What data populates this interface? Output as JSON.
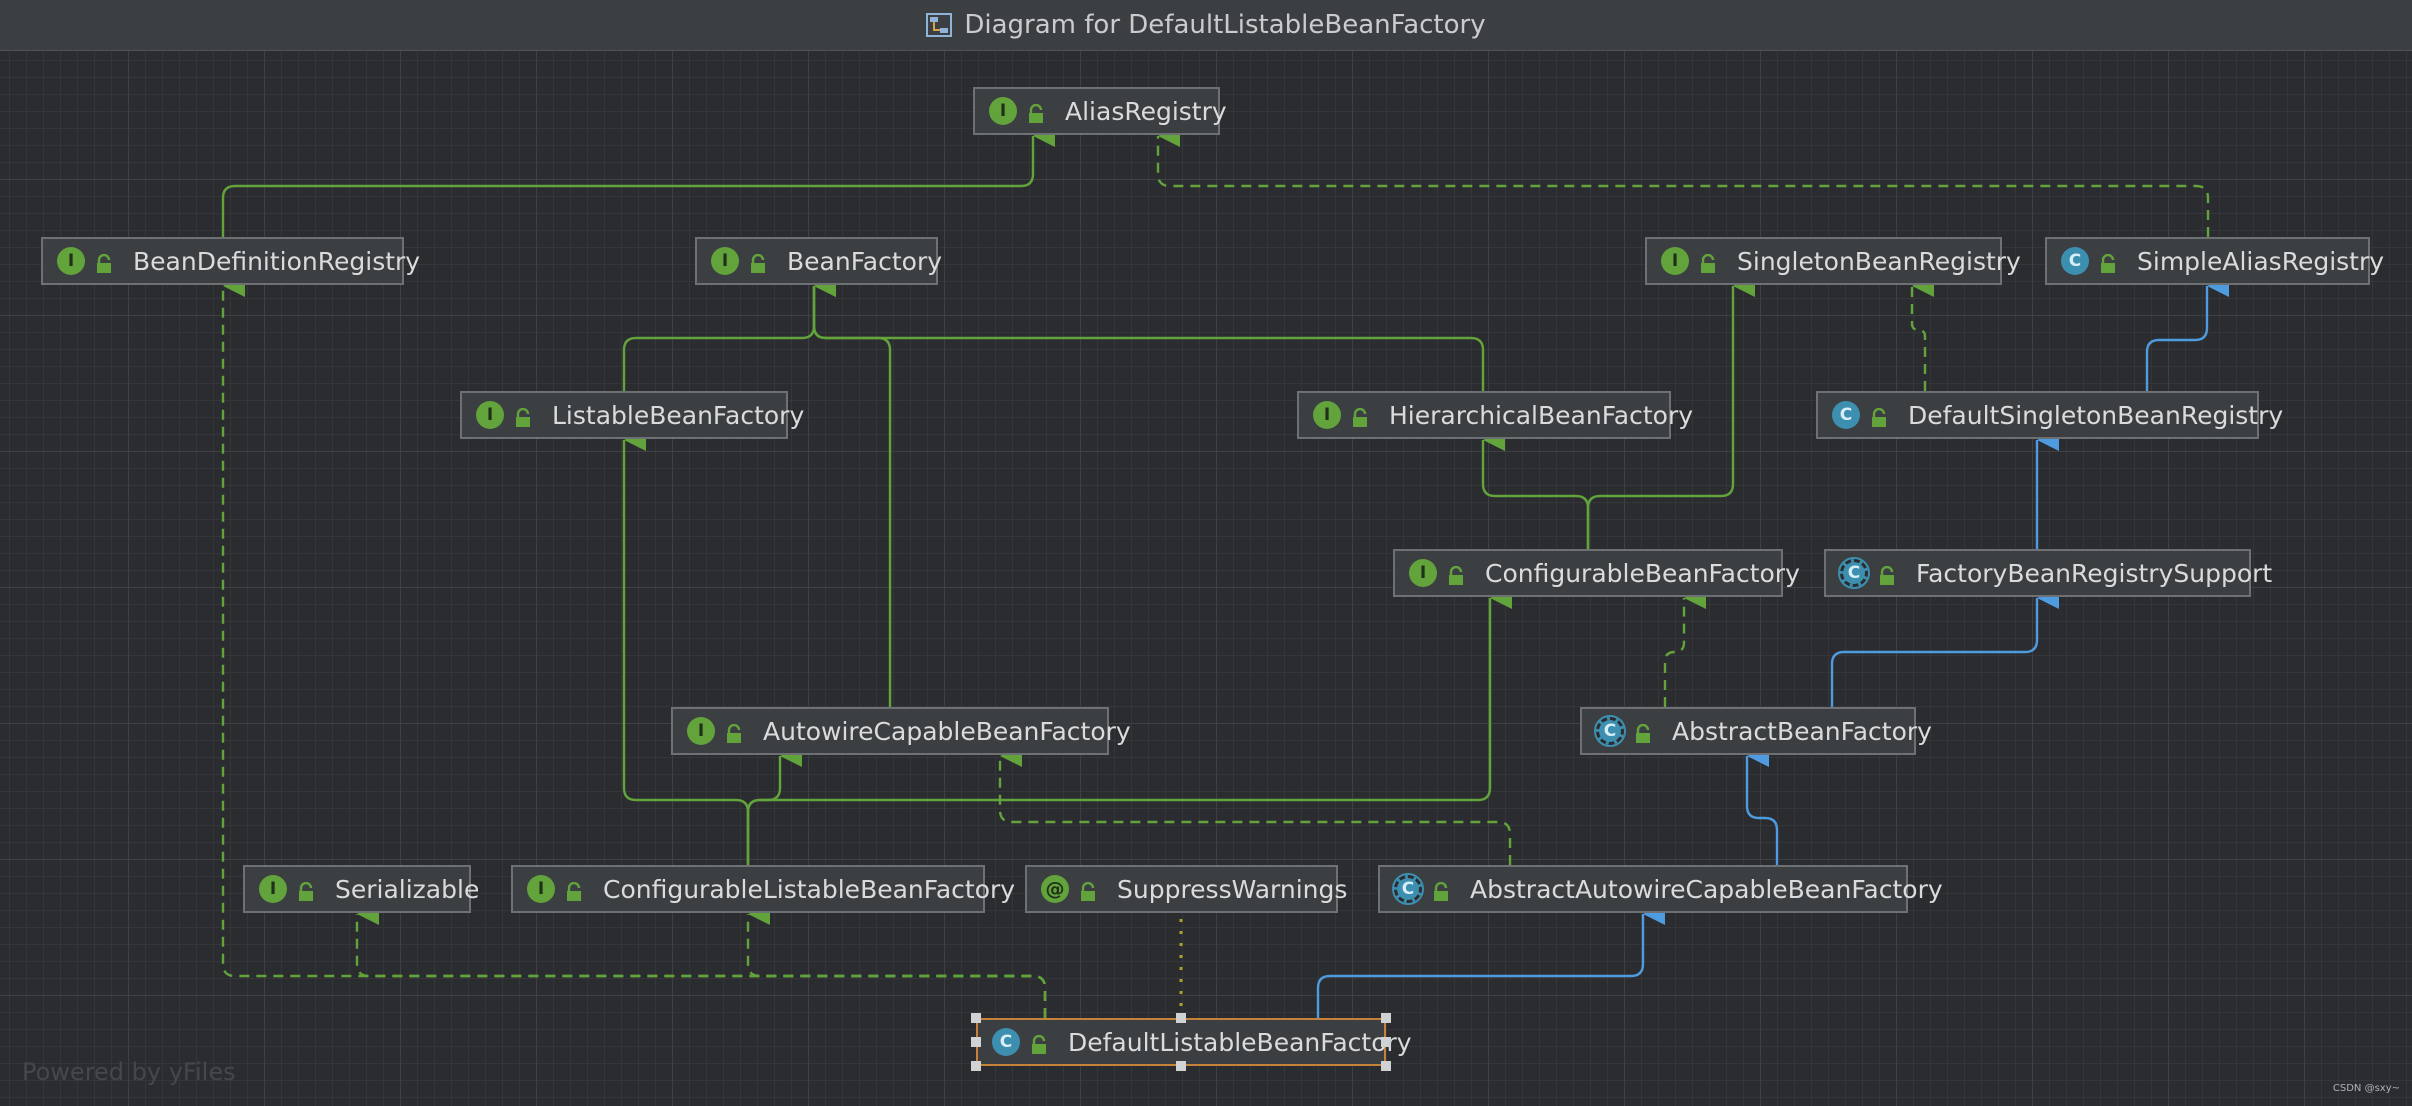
{
  "window": {
    "title": "Diagram for DefaultListableBeanFactory",
    "icon": "diagram-icon"
  },
  "colors": {
    "inheritance": "#62a33c",
    "class_inheritance": "#4f9be0",
    "annotation_link": "#a7a32b",
    "selection": "#c7823a",
    "interface_badge": "#62a33c",
    "class_badge": "#3d8fb0"
  },
  "nodes": [
    {
      "id": "AliasRegistry",
      "kind": "interface",
      "label": "AliasRegistry"
    },
    {
      "id": "BeanDefinitionRegistry",
      "kind": "interface",
      "label": "BeanDefinitionRegistry"
    },
    {
      "id": "BeanFactory",
      "kind": "interface",
      "label": "BeanFactory"
    },
    {
      "id": "SingletonBeanRegistry",
      "kind": "interface",
      "label": "SingletonBeanRegistry"
    },
    {
      "id": "SimpleAliasRegistry",
      "kind": "class",
      "label": "SimpleAliasRegistry"
    },
    {
      "id": "ListableBeanFactory",
      "kind": "interface",
      "label": "ListableBeanFactory"
    },
    {
      "id": "HierarchicalBeanFactory",
      "kind": "interface",
      "label": "HierarchicalBeanFactory"
    },
    {
      "id": "DefaultSingletonBeanRegistry",
      "kind": "class",
      "label": "DefaultSingletonBeanRegistry"
    },
    {
      "id": "ConfigurableBeanFactory",
      "kind": "interface",
      "label": "ConfigurableBeanFactory"
    },
    {
      "id": "FactoryBeanRegistrySupport",
      "kind": "abstract",
      "label": "FactoryBeanRegistrySupport"
    },
    {
      "id": "AutowireCapableBeanFactory",
      "kind": "interface",
      "label": "AutowireCapableBeanFactory"
    },
    {
      "id": "AbstractBeanFactory",
      "kind": "abstract",
      "label": "AbstractBeanFactory"
    },
    {
      "id": "Serializable",
      "kind": "interface",
      "label": "Serializable"
    },
    {
      "id": "ConfigurableListableBeanFactory",
      "kind": "interface",
      "label": "ConfigurableListableBeanFactory"
    },
    {
      "id": "SuppressWarnings",
      "kind": "annotation",
      "label": "SuppressWarnings"
    },
    {
      "id": "AbstractAutowireCapableBeanFactory",
      "kind": "abstract",
      "label": "AbstractAutowireCapableBeanFactory"
    },
    {
      "id": "DefaultListableBeanFactory",
      "kind": "class",
      "label": "DefaultListableBeanFactory",
      "selected": true
    }
  ],
  "badges": {
    "interface": "I",
    "class": "C",
    "abstract": "C",
    "annotation": "@"
  },
  "edges": [
    {
      "from": "BeanDefinitionRegistry",
      "to": "AliasRegistry",
      "type": "extends"
    },
    {
      "from": "SimpleAliasRegistry",
      "to": "AliasRegistry",
      "type": "implements"
    },
    {
      "from": "ListableBeanFactory",
      "to": "BeanFactory",
      "type": "extends"
    },
    {
      "from": "HierarchicalBeanFactory",
      "to": "BeanFactory",
      "type": "extends"
    },
    {
      "from": "AutowireCapableBeanFactory",
      "to": "BeanFactory",
      "type": "extends"
    },
    {
      "from": "DefaultSingletonBeanRegistry",
      "to": "SingletonBeanRegistry",
      "type": "implements"
    },
    {
      "from": "DefaultSingletonBeanRegistry",
      "to": "SimpleAliasRegistry",
      "type": "class-extends"
    },
    {
      "from": "ConfigurableBeanFactory",
      "to": "HierarchicalBeanFactory",
      "type": "extends"
    },
    {
      "from": "ConfigurableBeanFactory",
      "to": "SingletonBeanRegistry",
      "type": "extends"
    },
    {
      "from": "FactoryBeanRegistrySupport",
      "to": "DefaultSingletonBeanRegistry",
      "type": "class-extends"
    },
    {
      "from": "AbstractBeanFactory",
      "to": "FactoryBeanRegistrySupport",
      "type": "class-extends"
    },
    {
      "from": "AbstractBeanFactory",
      "to": "ConfigurableBeanFactory",
      "type": "implements"
    },
    {
      "from": "ConfigurableListableBeanFactory",
      "to": "ListableBeanFactory",
      "type": "extends"
    },
    {
      "from": "ConfigurableListableBeanFactory",
      "to": "AutowireCapableBeanFactory",
      "type": "extends"
    },
    {
      "from": "ConfigurableListableBeanFactory",
      "to": "ConfigurableBeanFactory",
      "type": "extends"
    },
    {
      "from": "AbstractAutowireCapableBeanFactory",
      "to": "AutowireCapableBeanFactory",
      "type": "implements"
    },
    {
      "from": "AbstractAutowireCapableBeanFactory",
      "to": "AbstractBeanFactory",
      "type": "class-extends"
    },
    {
      "from": "DefaultListableBeanFactory",
      "to": "BeanDefinitionRegistry",
      "type": "implements"
    },
    {
      "from": "DefaultListableBeanFactory",
      "to": "Serializable",
      "type": "implements"
    },
    {
      "from": "DefaultListableBeanFactory",
      "to": "ConfigurableListableBeanFactory",
      "type": "implements"
    },
    {
      "from": "DefaultListableBeanFactory",
      "to": "SuppressWarnings",
      "type": "annotated"
    },
    {
      "from": "DefaultListableBeanFactory",
      "to": "AbstractAutowireCapableBeanFactory",
      "type": "class-extends"
    }
  ],
  "footer": {
    "watermark": "Powered by yFiles",
    "credit": "CSDN @sxy~"
  }
}
